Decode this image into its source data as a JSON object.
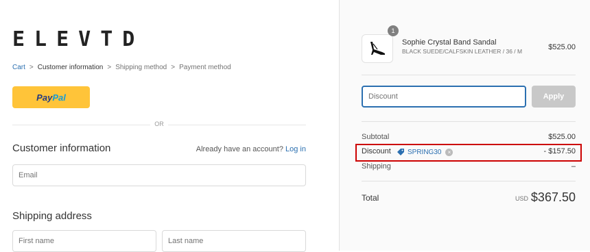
{
  "brand": {
    "logo": "ELEVTD"
  },
  "breadcrumb": {
    "items": [
      {
        "label": "Cart"
      },
      {
        "label": "Customer information"
      },
      {
        "label": "Shipping method"
      },
      {
        "label": "Payment method"
      }
    ]
  },
  "paypal": {
    "pay": "Pay",
    "pal": "Pal"
  },
  "divider": {
    "text": "OR"
  },
  "customer": {
    "title": "Customer information",
    "login_prompt": "Already have an account?",
    "login_link": "Log in",
    "email_placeholder": "Email"
  },
  "shipping": {
    "title": "Shipping address",
    "first_name_placeholder": "First name",
    "last_name_placeholder": "Last name"
  },
  "order": {
    "product": {
      "quantity": "1",
      "name": "Sophie Crystal Band Sandal",
      "variant": "BLACK SUEDE/CALFSKIN LEATHER / 36 / M",
      "price": "$525.00"
    },
    "discount_input": {
      "placeholder": "Discount"
    },
    "apply_label": "Apply",
    "subtotal": {
      "label": "Subtotal",
      "value": "$525.00"
    },
    "discount": {
      "label": "Discount",
      "code": "SPRING30",
      "value": "- $157.50"
    },
    "shipping": {
      "label": "Shipping",
      "value": "–"
    },
    "total": {
      "label": "Total",
      "currency": "USD",
      "value": "$367.50"
    }
  },
  "colors": {
    "accent": "#2a6fb0",
    "paypal_yellow": "#ffc439",
    "highlight_red": "#cc0000"
  }
}
